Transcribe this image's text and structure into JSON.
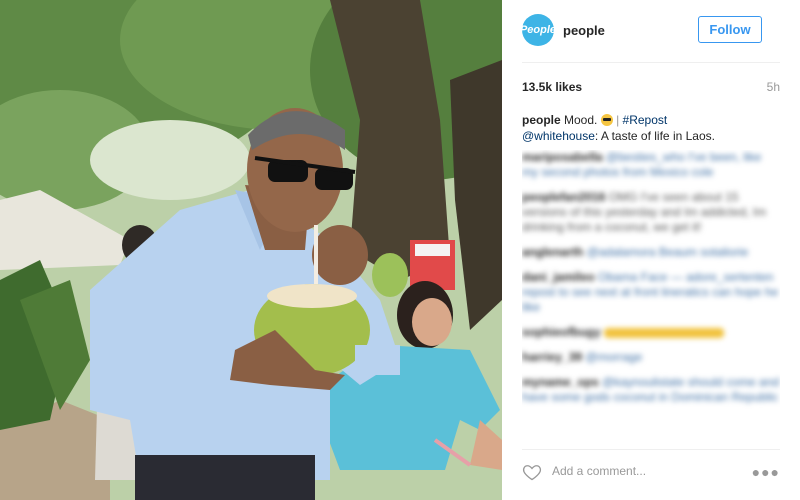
{
  "post": {
    "username": "people",
    "avatar_text": "People",
    "follow_label": "Follow",
    "likes": "13.5k likes",
    "time": "5h",
    "caption": {
      "author": "people",
      "text": "Mood.",
      "emoji": "sunglasses-emoji",
      "separator": "|",
      "hashtag": "#Repost",
      "mention": "@whitehouse",
      "body": ": A taste of life in Laos."
    },
    "comment_placeholder": "Add a comment...",
    "more_icon": "more-options-icon",
    "like_icon": "heart-icon"
  },
  "blurred_comments": [
    {
      "user": "mariposabella",
      "text": "@besties_who I've been, like my second photos from Mexico cole"
    },
    {
      "user": "peoplefan2016",
      "text": "OMG I've seen about 15 versions of this yesterday and Im addicted, Im drinking from a coconut, we get it!"
    },
    {
      "user": "anglenarth",
      "text": "@adalamora Beaum sotaliorie"
    },
    {
      "user": "dani_jamileo",
      "text": "Obama Face — adore_sertenten repost to see next at front lineratics can hope he like"
    },
    {
      "user": "sophieofbugy",
      "text": ""
    },
    {
      "user": "harriey_39",
      "text": "@morrage"
    },
    {
      "user": "myname_ops",
      "text": "@kaynoulistate should come and have some gods coconut in Dominican Republic"
    }
  ],
  "colors": {
    "accent": "#3897f0",
    "brand": "#3db4e6",
    "text": "#262626",
    "muted": "#999999"
  }
}
